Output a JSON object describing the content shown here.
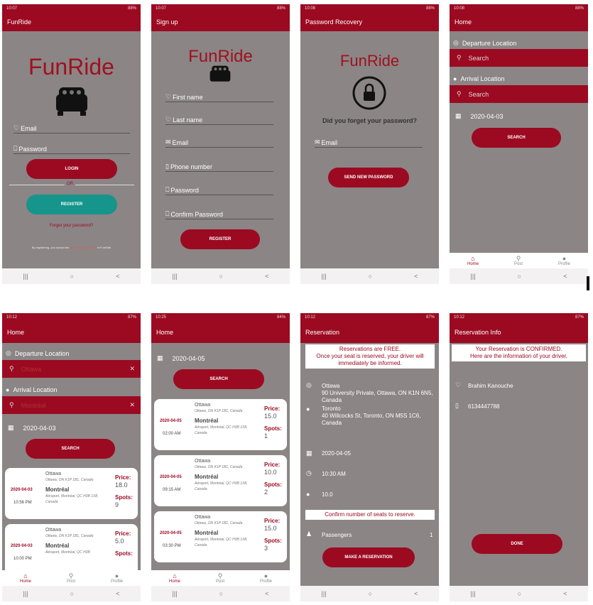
{
  "status": {
    "s1": "10:07",
    "s2": "10:07",
    "s3": "10:08",
    "s4": "10:08",
    "s5": "10:12",
    "s6": "10:25",
    "s7": "10:12",
    "s8": "10:12",
    "b1": "88%",
    "b2": "88%",
    "b3": "88%",
    "b4": "88%",
    "b5": "87%",
    "b6": "84%",
    "b7": "87%",
    "b8": "87%"
  },
  "screen1": {
    "appbar": "FunRide",
    "logo": "FunRide",
    "email": "Email",
    "password": "Password",
    "login": "LOGIN",
    "or": "OR",
    "register": "REGISTER",
    "forgot": "Forgot your password?",
    "terms_pre": "By registering, you accept the",
    "terms_link": "terms and conditions",
    "terms_post": "of FunRide."
  },
  "screen2": {
    "appbar": "Sign up",
    "logo": "FunRide",
    "first": "First name",
    "last": "Last name",
    "email": "Email",
    "phone": "Phone number",
    "password": "Password",
    "confirm": "Confirm Password",
    "register": "REGISTER"
  },
  "screen3": {
    "appbar": "Password Recovery",
    "logo": "FunRide",
    "question": "Did you forget your password?",
    "email": "Email",
    "send": "SEND NEW PASSWORD"
  },
  "screen4": {
    "appbar": "Home",
    "dep": "Departure Location",
    "arr": "Arrival Location",
    "search1": "Search",
    "search2": "Search",
    "date": "2020-04-03",
    "search_btn": "SEARCH"
  },
  "tabs": {
    "home": "Home",
    "post": "Post",
    "profile": "Profile"
  },
  "screen5": {
    "appbar": "Home",
    "dep": "Departure Location",
    "arr": "Arrival Location",
    "dep_value": "Ottawa",
    "arr_value": "Montréal",
    "date": "2020-04-03",
    "search_btn": "SEARCH",
    "cards": [
      {
        "date": "2020-04-03",
        "time": "10:56 PM",
        "from": "Ottawa",
        "from_addr": "Ottawa, ON K1P 1B1, Canada",
        "to": "Montréal",
        "to_addr": "Aéroport, Montréal, QC H3B 1X8, Canada",
        "price_label": "Price:",
        "price": "18.0",
        "spots_label": "Spots:",
        "spots": "9"
      },
      {
        "date": "2020-04-03",
        "time": "10:00 PM",
        "from": "Ottawa",
        "from_addr": "Ottawa, ON K1P 1B1, Canada",
        "to": "Montréal",
        "to_addr": "Aéroport, Montréal, QC H3B",
        "price_label": "Price:",
        "price": "5.0",
        "spots_label": "Spots:",
        "spots": ""
      }
    ]
  },
  "screen6": {
    "appbar": "Home",
    "date": "2020-04-05",
    "search_btn": "SEARCH",
    "cards": [
      {
        "date": "2020-04-05",
        "time": "02:00 AM",
        "from": "Ottawa",
        "from_addr": "Ottawa, ON K1P 1B1, Canada",
        "to": "Montréal",
        "to_addr": "Aéroport, Montréal, QC H3B 1X8, Canada",
        "price_label": "Price:",
        "price": "15.0",
        "spots_label": "Spots:",
        "spots": "1"
      },
      {
        "date": "2020-04-05",
        "time": "09:15 AM",
        "from": "Ottawa",
        "from_addr": "Ottawa, ON K1P 1B1, Canada",
        "to": "Montréal",
        "to_addr": "Aéroport, Montréal, QC H3B 1X8, Canada",
        "price_label": "Price:",
        "price": "10.0",
        "spots_label": "Spots:",
        "spots": "2"
      },
      {
        "date": "2020-04-05",
        "time": "03:30 PM",
        "from": "Ottawa",
        "from_addr": "Ottawa, ON K1P 1B1, Canada",
        "to": "Montréal",
        "to_addr": "Aéroport, Montréal, QC H3B 1X8, Canada",
        "price_label": "Price:",
        "price": "15.0",
        "spots_label": "Spots:",
        "spots": "3"
      }
    ]
  },
  "screen7": {
    "appbar": "Reservation",
    "notice": "Reservations are FREE.\nOnce your seat is reserved, your driver will immediately be informed.",
    "from_city": "Ottawa",
    "from_addr": "90 University Private, Ottawa, ON K1N 6N5, Canada",
    "to_city": "Toronto",
    "to_addr": "40 Willcocks St, Toronto, ON M5S 1C6, Canada",
    "date": "2020-04-05",
    "time": "10:30 AM",
    "price": "10.0",
    "confirm": "Confirm number of seats to reserve.",
    "passengers": "Passengers",
    "passengers_count": "1",
    "make": "MAKE A RESERVATION"
  },
  "screen8": {
    "appbar": "Reservation Info",
    "notice": "Your Reservation is CONFIRMED.\nHere are the information of your driver.",
    "driver": "Brahim  Kanouche",
    "phone": "6134447788",
    "done": "DONE"
  }
}
